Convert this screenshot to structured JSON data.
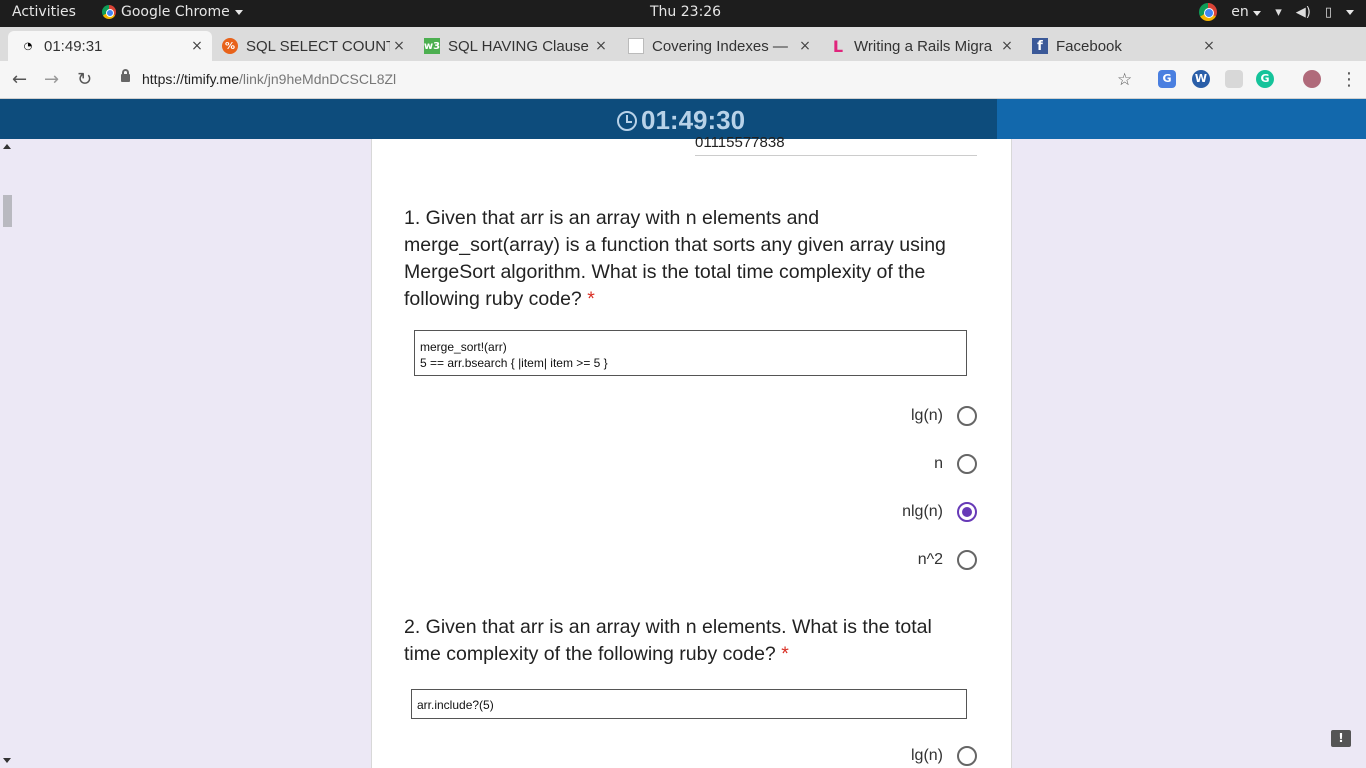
{
  "system": {
    "activities": "Activities",
    "app_name": "Google Chrome",
    "clock": "Thu 23:26",
    "lang": "en"
  },
  "tabs": [
    {
      "title": "01:49:31",
      "close": "×"
    },
    {
      "title": "SQL SELECT COUNT,",
      "close": "×"
    },
    {
      "title": "SQL HAVING Clause",
      "close": "×"
    },
    {
      "title": "Covering Indexes —",
      "close": "×"
    },
    {
      "title": "Writing a Rails Migra",
      "close": "×"
    },
    {
      "title": "Facebook",
      "close": "×"
    }
  ],
  "address": {
    "domain": "https://timify.me",
    "path": "/link/jn9heMdnDCSCL8Zl"
  },
  "timer": "01:49:30",
  "prev_answer": "01115577838",
  "questions": [
    {
      "text": "1. Given that arr is an array with n elements and merge_sort(array) is a function that sorts any given array using MergeSort algorithm. What is the total time complexity of the following ruby code?",
      "required": "*",
      "code": "merge_sort!(arr)\n5 == arr.bsearch { |item| item >= 5 }",
      "options": [
        {
          "label": "lg(n)",
          "selected": false
        },
        {
          "label": "n",
          "selected": false
        },
        {
          "label": "nlg(n)",
          "selected": true
        },
        {
          "label": "n^2",
          "selected": false
        }
      ]
    },
    {
      "text": "2. Given that arr is an array with n elements. What is the total time complexity of the following ruby code?",
      "required": "*",
      "code": "arr.include?(5)",
      "options": [
        {
          "label": "lg(n)",
          "selected": false
        }
      ]
    }
  ],
  "colors": {
    "timer_bar": "#0d4c7c",
    "accent": "#673ab7",
    "required": "#d93025"
  }
}
